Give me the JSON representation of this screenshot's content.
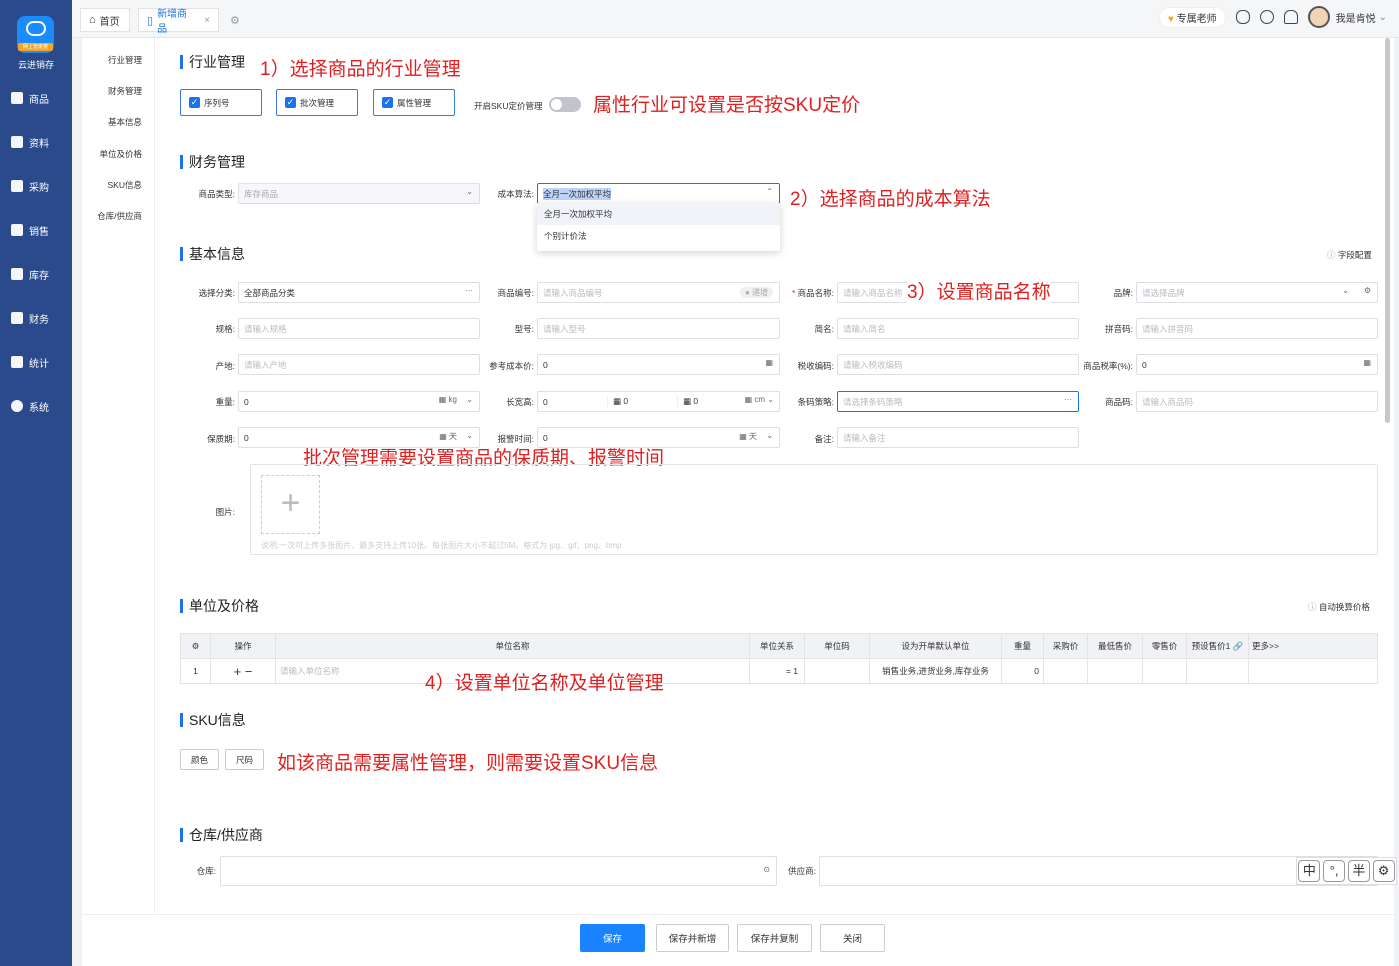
{
  "app": {
    "brand": "云进销存",
    "logo_badge": "网上管家婆"
  },
  "sidebar": {
    "items": [
      {
        "label": "商品",
        "icon": "bag-icon"
      },
      {
        "label": "资料",
        "icon": "document-icon"
      },
      {
        "label": "采购",
        "icon": "purchase-icon"
      },
      {
        "label": "销售",
        "icon": "chart-icon"
      },
      {
        "label": "库存",
        "icon": "warehouse-icon"
      },
      {
        "label": "财务",
        "icon": "finance-icon"
      },
      {
        "label": "统计",
        "icon": "stats-icon"
      },
      {
        "label": "系统",
        "icon": "gear-icon"
      }
    ]
  },
  "tabs": {
    "home": "首页",
    "new_product": "新增商品",
    "close": "×"
  },
  "topbar": {
    "teacher": "专属老师",
    "user": "我是肯悦"
  },
  "subnav": [
    "行业管理",
    "财务管理",
    "基本信息",
    "单位及价格",
    "SKU信息",
    "仓库/供应商"
  ],
  "industry": {
    "title": "行业管理",
    "checks": [
      "序列号",
      "批次管理",
      "属性管理"
    ],
    "sku_price_label": "开启SKU定价管理"
  },
  "finance": {
    "title": "财务管理",
    "type_label": "商品类型:",
    "type_value": "库存商品",
    "cost_label": "成本算法:",
    "cost_value": "全月一次加权平均",
    "options": [
      "全月一次加权平均",
      "个别计价法"
    ]
  },
  "basic": {
    "title": "基本信息",
    "field_config": "字段配置",
    "category_label": "选择分类:",
    "category_value": "全部商品分类",
    "code_label": "商品编号:",
    "code_ph": "请输入商品编号",
    "code_tag": "● 递增",
    "name_label": "商品名称:",
    "name_ph": "请输入商品名称",
    "brand_label": "品牌:",
    "brand_ph": "请选择品牌",
    "spec_label": "规格:",
    "spec_ph": "请输入规格",
    "model_label": "型号:",
    "model_ph": "请输入型号",
    "short_label": "简名:",
    "short_ph": "请输入简名",
    "pinyin_label": "拼音码:",
    "pinyin_ph": "请输入拼音码",
    "origin_label": "产地:",
    "origin_ph": "请输入产地",
    "refcost_label": "参考成本价:",
    "refcost_value": "0",
    "tax_label": "税收编码:",
    "tax_ph": "请输入税收编码",
    "taxrate_label": "商品税率(%):",
    "taxrate_value": "0",
    "weight_label": "重量:",
    "weight_value": "0",
    "weight_unit": "kg",
    "lwh_label": "长宽高:",
    "lwh_values": [
      "0",
      "0",
      "0"
    ],
    "lwh_unit": "cm",
    "barcode_label": "条码策略:",
    "barcode_ph": "请选择条码策略",
    "prodcode_label": "商品码:",
    "prodcode_ph": "请输入商品码",
    "shelf_label": "保质期:",
    "shelf_value": "0",
    "shelf_unit": "天",
    "alarm_label": "报警时间:",
    "alarm_value": "0",
    "alarm_unit": "天",
    "remark_label": "备注:",
    "remark_ph": "请输入备注",
    "image_label": "图片:",
    "image_hint": "说明:一次可上传多张图片、最多支持上传10张。每张图片大小不超过5M。格式为 jpg、gif、png、bmp"
  },
  "unit": {
    "title": "单位及价格",
    "auto_calc": "自动换算价格",
    "headers": [
      "操作",
      "单位名称",
      "单位关系",
      "单位码",
      "设为开单默认单位",
      "重量",
      "采购价",
      "最低售价",
      "零售价",
      "预设售价1",
      "更多>>"
    ],
    "row": {
      "index": "1",
      "ops": "+ −",
      "name_ph": "请输入单位名称",
      "relation": "= 1",
      "default_unit": "销售业务,进货业务,库存业务",
      "weight": "0"
    }
  },
  "sku": {
    "title": "SKU信息",
    "buttons": [
      "颜色",
      "尺码"
    ]
  },
  "warehouse": {
    "title": "仓库/供应商",
    "wh_label": "仓库:",
    "sup_label": "供应商:"
  },
  "footer": {
    "save": "保存",
    "save_new": "保存并新增",
    "save_copy": "保存并复制",
    "close": "关闭"
  },
  "annotations": {
    "a1": "1）选择商品的行业管理",
    "a2": "属性行业可设置是否按SKU定价",
    "a3": "2）选择商品的成本算法",
    "a4": "3）设置商品名称",
    "a5": "批次管理需要设置商品的保质期、报警时间",
    "a6": "4）设置单位名称及单位管理",
    "a7": "如该商品需要属性管理，则需要设置SKU信息"
  },
  "ime": [
    "中",
    "°,",
    "半",
    "⚙"
  ]
}
